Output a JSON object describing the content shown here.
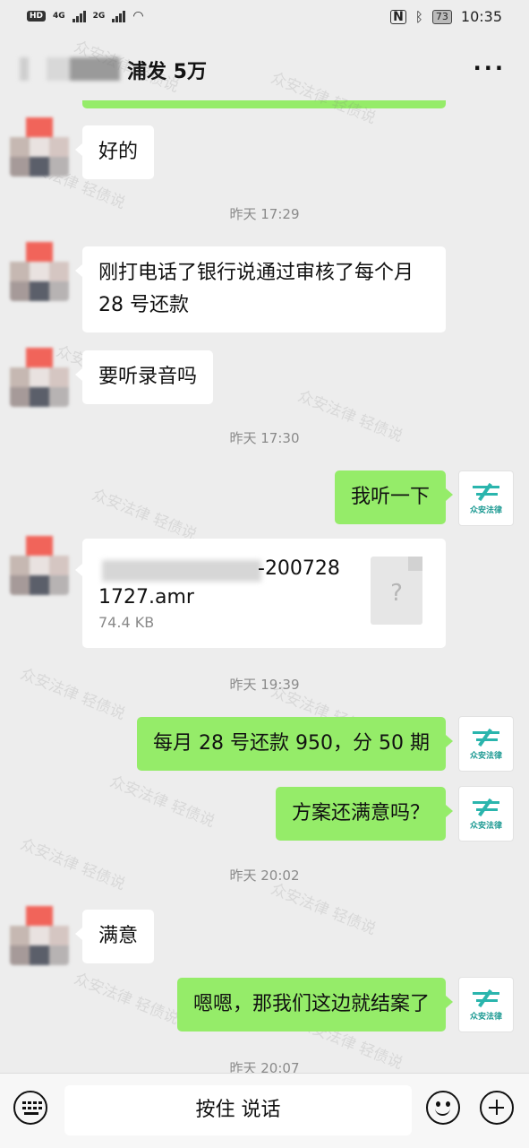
{
  "status_bar": {
    "hd": "HD",
    "network1": "4G",
    "network2": "2G",
    "battery": "73",
    "time": "10:35"
  },
  "header": {
    "title": "浦发 5万",
    "more": "···"
  },
  "messages": {
    "m1": "好的",
    "t1": "昨天 17:29",
    "m2": "刚打电话了银行说通过审核了每个月 28 号还款",
    "m3": "要听录音吗",
    "t2": "昨天 17:30",
    "m4": "我听一下",
    "file_name": "-2007281727.amr",
    "file_size": "74.4 KB",
    "file_icon": "?",
    "t3": "昨天 19:39",
    "m5": "每月 28 号还款 950，分 50 期",
    "m6": "方案还满意吗？",
    "t4": "昨天 20:02",
    "m7": "满意",
    "m8": "嗯嗯，那我们这边就结案了",
    "t5": "昨天 20:07"
  },
  "me_avatar_text": "众安法律",
  "watermark": "众安法律 轻债说",
  "input": {
    "talk_label": "按住 说话"
  },
  "icons": {
    "keyboard": "keyboard-icon",
    "emoji": "emoji-icon",
    "plus": "plus-icon",
    "more": "more-icon",
    "wifi": "wifi-icon",
    "battery": "battery-icon"
  },
  "colors": {
    "background": "#ededed",
    "bubble_out": "#95ec69",
    "bubble_in": "#ffffff",
    "timestamp": "#8a8a8a",
    "logo": "#2ab5ad"
  }
}
